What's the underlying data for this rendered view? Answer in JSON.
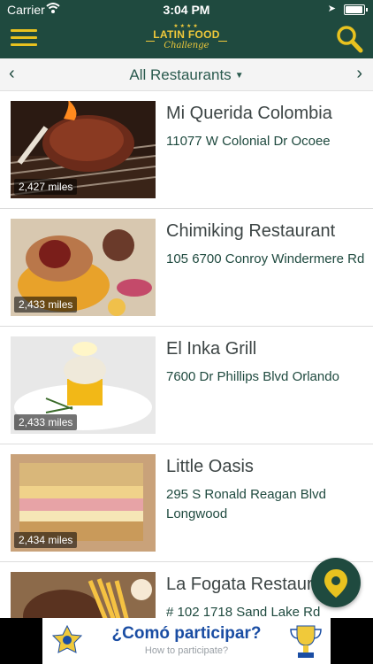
{
  "status_bar": {
    "carrier": "Carrier",
    "time": "3:04 PM"
  },
  "header": {
    "logo_title": "LATIN FOOD",
    "logo_subtitle": "Challenge",
    "accent_color": "#e8c21f",
    "bar_color": "#1f4a3f"
  },
  "filter": {
    "label": "All Restaurants",
    "prev_icon": "chevron-left-icon",
    "next_icon": "chevron-right-icon"
  },
  "restaurants": [
    {
      "name": "Mi Querida Colombia",
      "address": "11077 W Colonial Dr Ocoee",
      "distance": "2,427 miles"
    },
    {
      "name": "Chimiking Restaurant",
      "address": "105 6700 Conroy Windermere Rd",
      "distance": "2,433 miles"
    },
    {
      "name": "El Inka Grill",
      "address": "7600 Dr Phillips Blvd Orlando",
      "distance": "2,433 miles"
    },
    {
      "name": "Little Oasis",
      "address": "295 S Ronald Reagan Blvd Longwood",
      "distance": "2,434 miles"
    },
    {
      "name": "La Fogata Restaurant",
      "address": "# 102 1718 Sand Lake Rd",
      "distance": ""
    }
  ],
  "fab_icon": "map-pin-icon",
  "banner": {
    "question": "¿Comó participar?",
    "hint": "How to participate?"
  }
}
